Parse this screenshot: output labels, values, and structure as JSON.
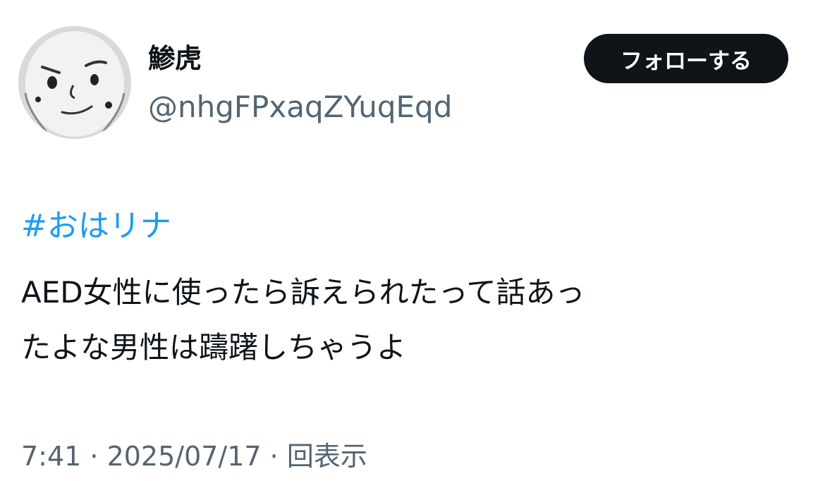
{
  "user": {
    "display_name": "鯵虎",
    "handle": "@nhgFPxaqZYuqEqd",
    "avatar_icon": "doodle-face-avatar"
  },
  "actions": {
    "follow_label": "フォローする"
  },
  "tweet": {
    "hashtag": "#おはリナ",
    "lines": [
      "AED女性に使ったら訴えられたって話あっ",
      "たよな男性は躊躇しちゃうよ"
    ],
    "meta": "7:41 · 2025/07/17 · 回表示"
  },
  "colors": {
    "text": "#0f1419",
    "secondary": "#536471",
    "link": "#1d9bf0",
    "button_bg": "#0f1419",
    "button_text": "#ffffff"
  }
}
